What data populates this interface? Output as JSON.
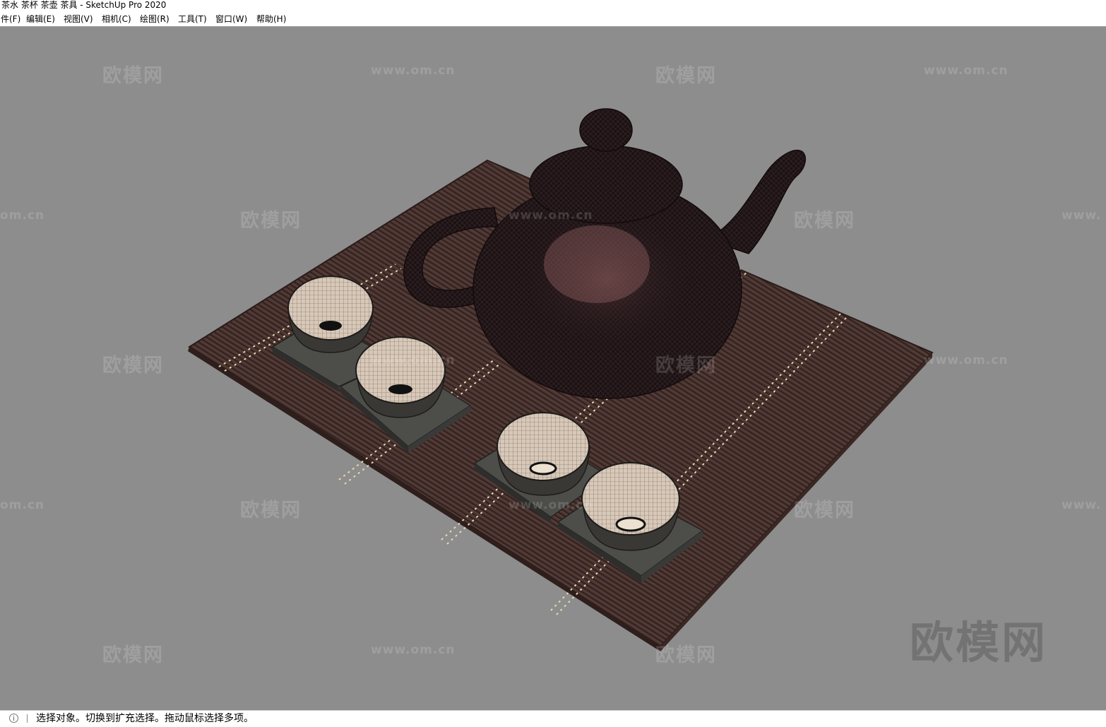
{
  "window": {
    "title": "茶水 茶杯 茶壶 茶具 - SketchUp Pro 2020"
  },
  "menu": {
    "items": [
      {
        "label": "件(F)"
      },
      {
        "label": "编辑(E)"
      },
      {
        "label": "视图(V)"
      },
      {
        "label": "相机(C)"
      },
      {
        "label": "绘图(R)"
      },
      {
        "label": "工具(T)"
      },
      {
        "label": "窗口(W)"
      },
      {
        "label": "帮助(H)"
      }
    ]
  },
  "watermarks": {
    "brand": "欧模网",
    "url": "www.om.cn",
    "url_cut": "om.cn",
    "url_cut_right": "www."
  },
  "scene": {
    "objects": [
      "teapot",
      "tea-cup",
      "tea-cup",
      "tea-cup",
      "tea-cup",
      "coaster",
      "bamboo-tea-mat"
    ],
    "colors": {
      "background": "#8d8d8d",
      "mat": "#4a3430",
      "teapot": "#1c1214",
      "cup_inner": "#d8c8b8",
      "coaster": "#4d4d4a"
    }
  },
  "status": {
    "icon": "info-icon",
    "message": "选择对象。切换到扩充选择。拖动鼠标选择多项。"
  }
}
